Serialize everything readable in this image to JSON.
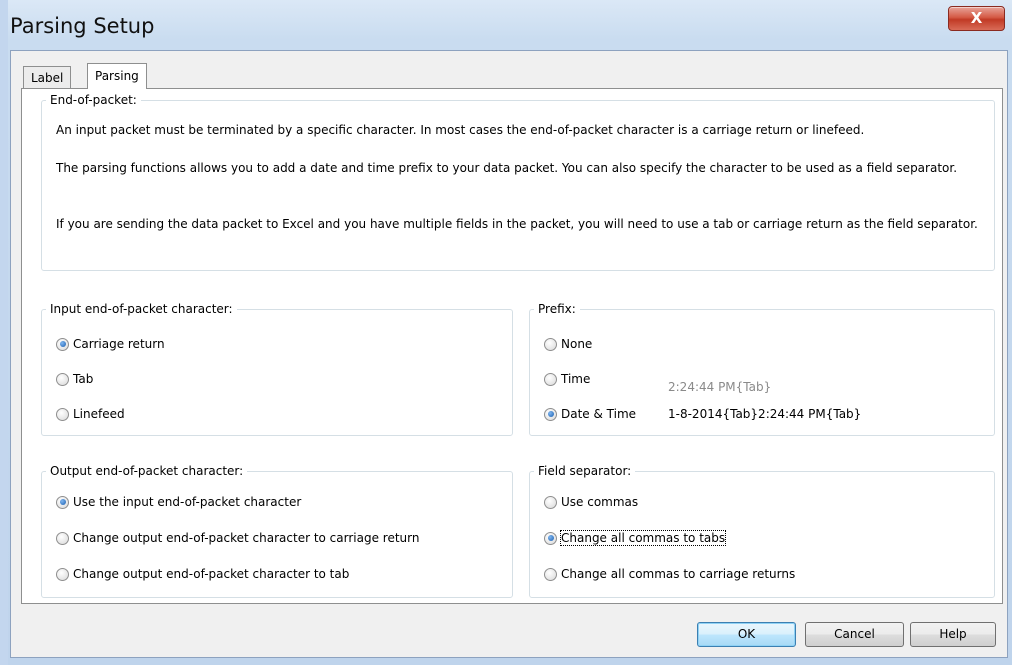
{
  "window": {
    "title": "Parsing Setup",
    "close_label": "X"
  },
  "tabs": [
    {
      "label": "Label",
      "active": false
    },
    {
      "label": "Parsing",
      "active": true
    }
  ],
  "end_of_packet": {
    "legend": "End-of-packet:",
    "paragraphs": [
      "An input packet must be terminated by a specific character.  In most cases the end-of-packet character is a carriage return or linefeed.",
      "The parsing functions allows you to add a date and time prefix to your data packet.  You can also specify the character to be used as a field separator.",
      "If you are sending the data packet to Excel and you have multiple fields in the packet, you will need to use a tab or carriage return as the field separator."
    ]
  },
  "input_eop": {
    "legend": "Input end-of-packet character:",
    "options": [
      {
        "label": "Carriage return",
        "checked": true
      },
      {
        "label": "Tab",
        "checked": false
      },
      {
        "label": "Linefeed",
        "checked": false
      }
    ]
  },
  "prefix": {
    "legend": "Prefix:",
    "options": [
      {
        "label": "None",
        "checked": false,
        "sample": ""
      },
      {
        "label": "Time",
        "checked": false,
        "sample": "2:24:44 PM{Tab}"
      },
      {
        "label": "Date & Time",
        "checked": true,
        "sample": "1-8-2014{Tab}2:24:44 PM{Tab}"
      }
    ]
  },
  "output_eop": {
    "legend": "Output end-of-packet character:",
    "options": [
      {
        "label": "Use the input end-of-packet character",
        "checked": true
      },
      {
        "label": "Change output end-of-packet character to carriage return",
        "checked": false
      },
      {
        "label": "Change output end-of-packet character to tab",
        "checked": false
      }
    ]
  },
  "field_separator": {
    "legend": "Field separator:",
    "options": [
      {
        "label": "Use commas",
        "checked": false
      },
      {
        "label": "Change all commas to tabs",
        "checked": true
      },
      {
        "label": "Change all commas to carriage returns",
        "checked": false
      }
    ]
  },
  "buttons": {
    "ok": "OK",
    "cancel": "Cancel",
    "help": "Help"
  }
}
